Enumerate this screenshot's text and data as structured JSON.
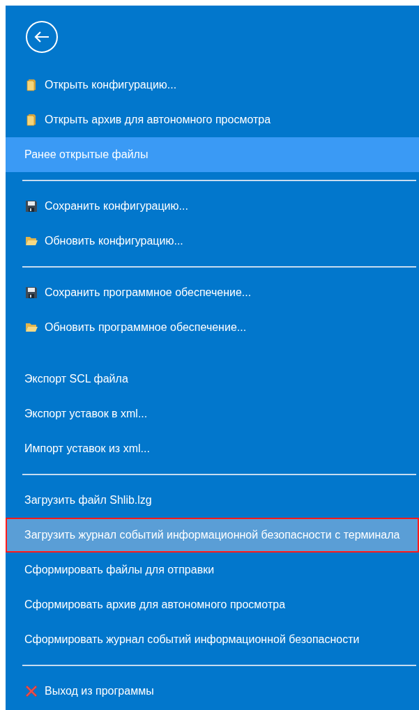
{
  "groups": [
    {
      "items": [
        {
          "kind": "open",
          "label": "Открыть конфигурацию...",
          "selected": false,
          "hovered": false,
          "marked": false
        },
        {
          "kind": "open",
          "label": "Открыть архив для автономного просмотра",
          "selected": false,
          "hovered": false,
          "marked": false
        },
        {
          "kind": "plain",
          "label": "Ранее открытые файлы",
          "selected": true,
          "hovered": false,
          "marked": false
        }
      ]
    },
    {
      "divider_before": true,
      "items": [
        {
          "kind": "save",
          "label": "Сохранить конфигурацию...",
          "selected": false,
          "hovered": false,
          "marked": false
        },
        {
          "kind": "update",
          "label": "Обновить конфигурацию...",
          "selected": false,
          "hovered": false,
          "marked": false
        }
      ]
    },
    {
      "divider_before": true,
      "items": [
        {
          "kind": "save",
          "label": "Сохранить программное обеспечение...",
          "selected": false,
          "hovered": false,
          "marked": false
        },
        {
          "kind": "update",
          "label": "Обновить программное обеспечение...",
          "selected": false,
          "hovered": false,
          "marked": false
        }
      ]
    },
    {
      "divider_before": false,
      "items": [
        {
          "kind": "plain",
          "label": "Экспорт SCL файла",
          "selected": false,
          "hovered": false,
          "marked": false
        },
        {
          "kind": "plain",
          "label": "Экспорт уставок в xml...",
          "selected": false,
          "hovered": false,
          "marked": false
        },
        {
          "kind": "plain",
          "label": "Импорт уставок из xml...",
          "selected": false,
          "hovered": false,
          "marked": false
        }
      ]
    },
    {
      "divider_before": true,
      "items": [
        {
          "kind": "plain",
          "label": "Загрузить файл Shlib.lzg",
          "selected": false,
          "hovered": false,
          "marked": false
        },
        {
          "kind": "plain",
          "label": "Загрузить журнал событий информационной безопасности с терминала",
          "selected": false,
          "hovered": true,
          "marked": true
        },
        {
          "kind": "plain",
          "label": "Сформировать файлы для отправки",
          "selected": false,
          "hovered": false,
          "marked": false
        },
        {
          "kind": "plain",
          "label": "Сформировать архив для автономного просмотра",
          "selected": false,
          "hovered": false,
          "marked": false
        },
        {
          "kind": "plain",
          "label": "Сформировать журнал событий информационной безопасности",
          "selected": false,
          "hovered": false,
          "marked": false
        }
      ]
    },
    {
      "divider_before": true,
      "items": [
        {
          "kind": "exit",
          "label": "Выход из программы",
          "selected": false,
          "hovered": false,
          "marked": false
        }
      ]
    }
  ]
}
